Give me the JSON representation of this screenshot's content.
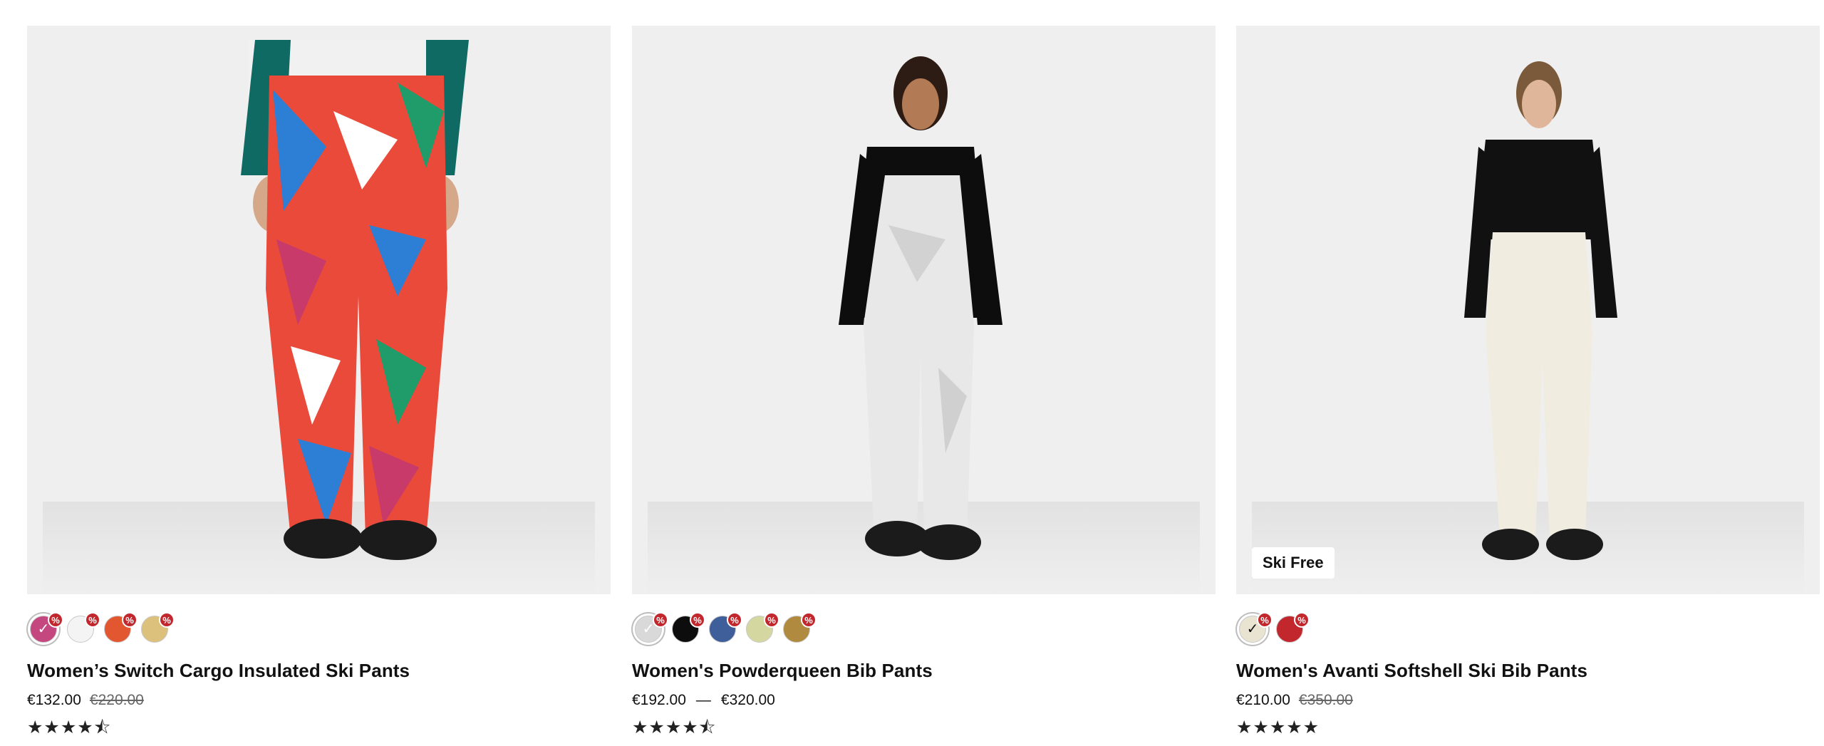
{
  "products": [
    {
      "name": "Women’s Switch Cargo Insulated Ski Pants",
      "price": "€132.00",
      "original_price": "€220.00",
      "rating": 4.5,
      "stars_text": "★★★★⯪",
      "badge": "",
      "swatches": [
        {
          "color": "#c4487f",
          "selected": true,
          "sale": true
        },
        {
          "color": "#f4f4f4",
          "selected": false,
          "sale": true
        },
        {
          "color": "#e2572f",
          "selected": false,
          "sale": true
        },
        {
          "color": "#dcc17c",
          "selected": false,
          "sale": true
        }
      ]
    },
    {
      "name": "Women's Powderqueen Bib Pants",
      "price_range": "€192.00 — €320.00",
      "price_from": "€192.00",
      "price_to": "€320.00",
      "rating": 4.5,
      "stars_text": "★★★★⯪",
      "badge": "",
      "swatches": [
        {
          "color": "#d9d9d9",
          "selected": true,
          "sale": true
        },
        {
          "color": "#0d0d0d",
          "selected": false,
          "sale": true
        },
        {
          "color": "#3f5f9a",
          "selected": false,
          "sale": true
        },
        {
          "color": "#d5d7a0",
          "selected": false,
          "sale": true
        },
        {
          "color": "#b08a3e",
          "selected": false,
          "sale": true
        }
      ]
    },
    {
      "name": "Women's Avanti Softshell Ski Bib Pants",
      "price": "€210.00",
      "original_price": "€350.00",
      "rating": 5,
      "stars_text": "★★★★★",
      "badge": "Ski Free",
      "swatches": [
        {
          "color": "#e9e3d2",
          "selected": true,
          "sale": true
        },
        {
          "color": "#c1272d",
          "selected": false,
          "sale": true
        }
      ]
    }
  ],
  "icons": {
    "selected_check": "✓",
    "sale_badge": "%"
  }
}
